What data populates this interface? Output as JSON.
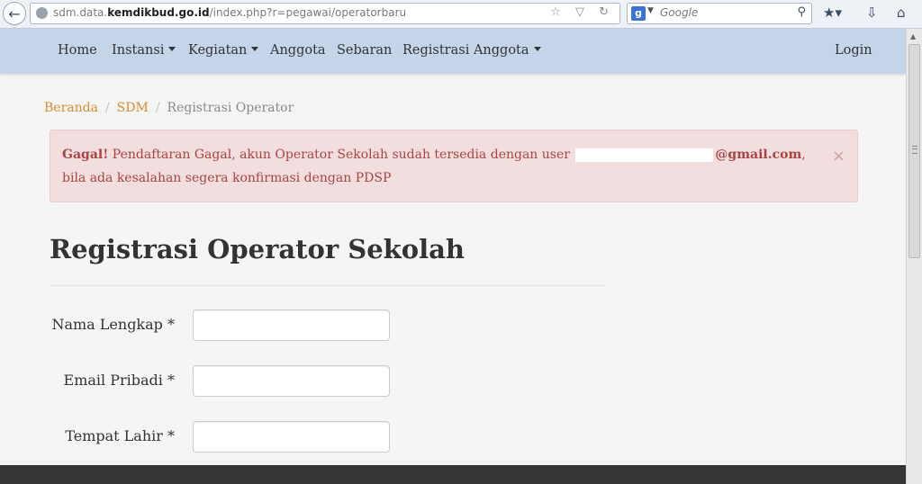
{
  "browser": {
    "url_prefix": "sdm.data.",
    "url_domain": "kemdikbud.go.id",
    "url_path": "/index.php?r=pegawai/operatorbaru",
    "url_icons": "☆ ▽ ↻",
    "search_engine_logo": "g",
    "search_placeholder": "Google",
    "icons": [
      "back-arrow-icon",
      "globe-icon",
      "bookmark-star-icon",
      "refresh-icon",
      "magnifier-icon",
      "downloads-icon",
      "home-icon"
    ]
  },
  "navbar": {
    "items": [
      {
        "label": "Home",
        "dropdown": false
      },
      {
        "label": "Instansi",
        "dropdown": true
      },
      {
        "label": "Kegiatan",
        "dropdown": true
      },
      {
        "label": "Anggota",
        "dropdown": false
      },
      {
        "label": "Sebaran",
        "dropdown": false
      },
      {
        "label": "Registrasi Anggota",
        "dropdown": true
      }
    ],
    "login_label": "Login",
    "bg_color": "#c4d4e9"
  },
  "breadcrumb": {
    "items": [
      "Beranda",
      "SDM"
    ],
    "active": "Registrasi Operator"
  },
  "alert": {
    "strong": "Gagal!",
    "text_before": " Pendaftaran Gagal, akun Operator Sekolah sudah tersedia dengan user ",
    "email_domain": "@gmail.com",
    "text_after": ", bila ada kesalahan segera konfirmasi dengan PDSP",
    "close": "×",
    "bg_color": "#f2dede",
    "text_color": "#a94442"
  },
  "page": {
    "title": "Registrasi Operator Sekolah"
  },
  "form": {
    "fields": [
      {
        "label": "Nama Lengkap *",
        "value": ""
      },
      {
        "label": "Email Pribadi *",
        "value": ""
      },
      {
        "label": "Tempat Lahir *",
        "value": ""
      }
    ]
  },
  "colors": {
    "link": "#dd8a2a",
    "footer": "#353535"
  }
}
